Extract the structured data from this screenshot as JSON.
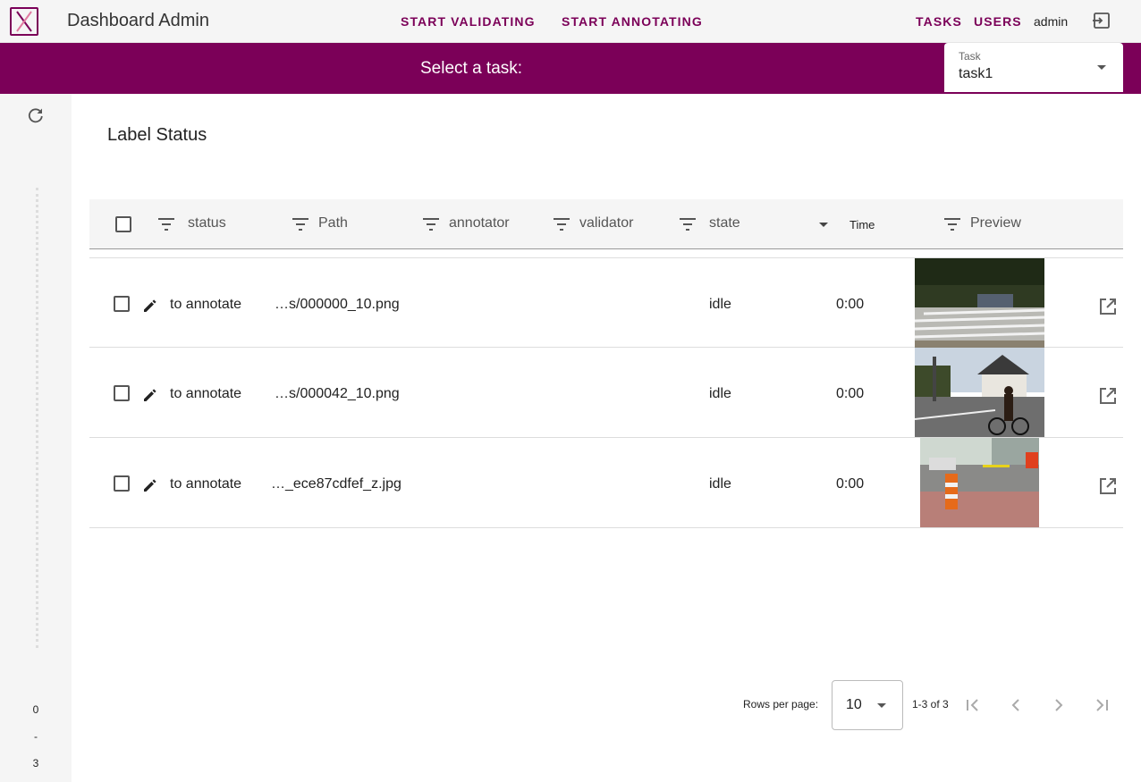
{
  "header": {
    "app_title": "Dashboard Admin",
    "nav": {
      "start_validating": "START VALIDATING",
      "start_annotating": "START ANNOTATING",
      "tasks": "TASKS",
      "users": "USERS"
    },
    "user": "admin",
    "accent_color": "#7b0058"
  },
  "task_bar": {
    "label": "Select a task:",
    "select_label": "Task",
    "select_value": "task1"
  },
  "left_rail": {
    "range_start": "0",
    "range_sep": "-",
    "range_end": "3"
  },
  "main": {
    "title": "Label Status",
    "columns": {
      "status": "status",
      "path": "Path",
      "annotator": "annotator",
      "validator": "validator",
      "state": "state",
      "time": "Time",
      "preview": "Preview"
    },
    "rows": [
      {
        "status": "to annotate",
        "path": "…s/000000_10.png",
        "annotator": "",
        "validator": "",
        "state": "idle",
        "time": "0:00",
        "preview": "street-crosswalk"
      },
      {
        "status": "to annotate",
        "path": "…s/000042_10.png",
        "annotator": "",
        "validator": "",
        "state": "idle",
        "time": "0:00",
        "preview": "cyclist-street"
      },
      {
        "status": "to annotate",
        "path": "…_ece87cdfef_z.jpg",
        "annotator": "",
        "validator": "",
        "state": "idle",
        "time": "0:00",
        "preview": "construction-street"
      }
    ]
  },
  "pagination": {
    "rows_per_page_label": "Rows per page:",
    "rows_per_page_value": "10",
    "range": "1-3 of 3"
  },
  "icons": {
    "logo": "app-logo-icon",
    "logout": "logout-icon",
    "refresh": "refresh-icon",
    "filter": "filter-icon",
    "edit": "pencil-icon",
    "open": "open-external-icon",
    "first_page": "first-page-icon",
    "prev_page": "chevron-left-icon",
    "next_page": "chevron-right-icon",
    "last_page": "last-page-icon"
  }
}
